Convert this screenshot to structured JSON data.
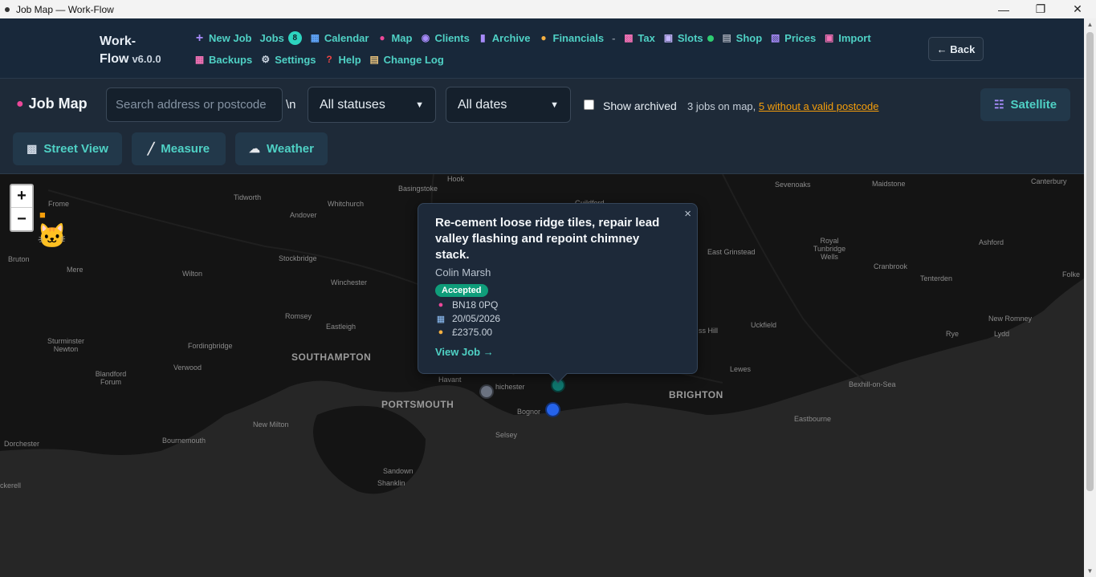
{
  "window": {
    "title": "Job Map — Work-Flow"
  },
  "brand": {
    "name_line1": "Work-",
    "name_line2": "Flow",
    "version": "v6.0.0"
  },
  "nav": {
    "new_job": "New Job",
    "jobs": "Jobs",
    "jobs_badge": "8",
    "calendar": "Calendar",
    "map": "Map",
    "clients": "Clients",
    "archive": "Archive",
    "financials": "Financials",
    "separator": "-",
    "tax": "Tax",
    "slots": "Slots",
    "shop": "Shop",
    "prices": "Prices",
    "import": "Import",
    "backups": "Backups",
    "settings": "Settings",
    "help": "Help",
    "change_log": "Change Log"
  },
  "back_button": "← Back",
  "toolbar": {
    "title": "Job Map",
    "search_placeholder": "Search address or postcode",
    "stray_text": "\\n",
    "status_filter": "All statuses",
    "date_filter": "All dates",
    "show_archived_label": "Show archived",
    "jobs_count_text": "3 jobs on map,",
    "invalid_postcode_link": "5 without a valid postcode",
    "satellite_button": "Satellite",
    "street_view_button": "Street View",
    "measure_button": "Measure",
    "weather_button": "Weather"
  },
  "map": {
    "zoom_in": "+",
    "zoom_out": "−",
    "places": [
      {
        "name": "Basingstoke",
        "type": "town"
      },
      {
        "name": "Hook",
        "type": "town"
      },
      {
        "name": "Sevenoaks",
        "type": "town"
      },
      {
        "name": "Maidstone",
        "type": "town"
      },
      {
        "name": "Canterbury",
        "type": "town"
      },
      {
        "name": "Frome",
        "type": "town"
      },
      {
        "name": "Tidworth",
        "type": "town"
      },
      {
        "name": "Whitchurch",
        "type": "town"
      },
      {
        "name": "Andover",
        "type": "town"
      },
      {
        "name": "Guildford",
        "type": "town"
      },
      {
        "name": "Bruton",
        "type": "town"
      },
      {
        "name": "Mere",
        "type": "town"
      },
      {
        "name": "Stockbridge",
        "type": "town"
      },
      {
        "name": "Wilton",
        "type": "town"
      },
      {
        "name": "Winchester",
        "type": "town"
      },
      {
        "name": "East Grinstead",
        "type": "town"
      },
      {
        "name": "Royal Tunbridge Wells",
        "type": "town"
      },
      {
        "name": "Ashford",
        "type": "town"
      },
      {
        "name": "Cranbrook",
        "type": "town"
      },
      {
        "name": "Tenterden",
        "type": "town"
      },
      {
        "name": "Folke",
        "type": "town"
      },
      {
        "name": "Romsey",
        "type": "town"
      },
      {
        "name": "Eastleigh",
        "type": "town"
      },
      {
        "name": "Uckfield",
        "type": "town"
      },
      {
        "name": "New Romney",
        "type": "town"
      },
      {
        "name": "Lydd",
        "type": "town"
      },
      {
        "name": "Rye",
        "type": "town"
      },
      {
        "name": "Sturminster Newton",
        "type": "town"
      },
      {
        "name": "Fordingbridge",
        "type": "town"
      },
      {
        "name": "SOUTHAMPTON",
        "type": "city"
      },
      {
        "name": "Verwood",
        "type": "town"
      },
      {
        "name": "ss Hill",
        "type": "town"
      },
      {
        "name": "Blandford Forum",
        "type": "town"
      },
      {
        "name": "Havant",
        "type": "town"
      },
      {
        "name": "hichester",
        "type": "town"
      },
      {
        "name": "Lewes",
        "type": "town"
      },
      {
        "name": "Bexhill-on-Sea",
        "type": "town"
      },
      {
        "name": "PORTSMOUTH",
        "type": "city"
      },
      {
        "name": "BRIGHTON",
        "type": "city"
      },
      {
        "name": "Bognor",
        "type": "town"
      },
      {
        "name": "Eastbourne",
        "type": "town"
      },
      {
        "name": "New Milton",
        "type": "town"
      },
      {
        "name": "Bournemouth",
        "type": "town"
      },
      {
        "name": "Selsey",
        "type": "town"
      },
      {
        "name": "Dorchester",
        "type": "town"
      },
      {
        "name": "Sandown",
        "type": "town"
      },
      {
        "name": "Shanklin",
        "type": "town"
      },
      {
        "name": "ckerell",
        "type": "town"
      }
    ]
  },
  "popup": {
    "close": "×",
    "title": "Re-cement loose ridge tiles, repair lead valley flashing and repoint chimney stack.",
    "client": "Colin Marsh",
    "status": "Accepted",
    "postcode": "BN18 0PQ",
    "date": "20/05/2026",
    "price": "£2375.00",
    "view_job": "View Job →"
  },
  "colors": {
    "accent": "#4fd1c5",
    "link_warning": "#f59e0b",
    "status_accepted": "#0f9d7a",
    "marker_grey": "#6b7280",
    "marker_teal": "#0f766e",
    "marker_blue": "#2563eb"
  },
  "icons": {
    "new_job": "plus-icon",
    "calendar": "calendar-icon",
    "map": "pin-icon",
    "clients": "people-icon",
    "archive": "archive-icon",
    "financials": "money-bag-icon",
    "tax": "chart-icon",
    "slots": "cart-icon",
    "shop": "shop-icon",
    "prices": "price-tag-icon",
    "import": "import-icon",
    "backups": "backup-icon",
    "settings": "gear-icon",
    "help": "question-icon",
    "change_log": "clipboard-icon"
  }
}
